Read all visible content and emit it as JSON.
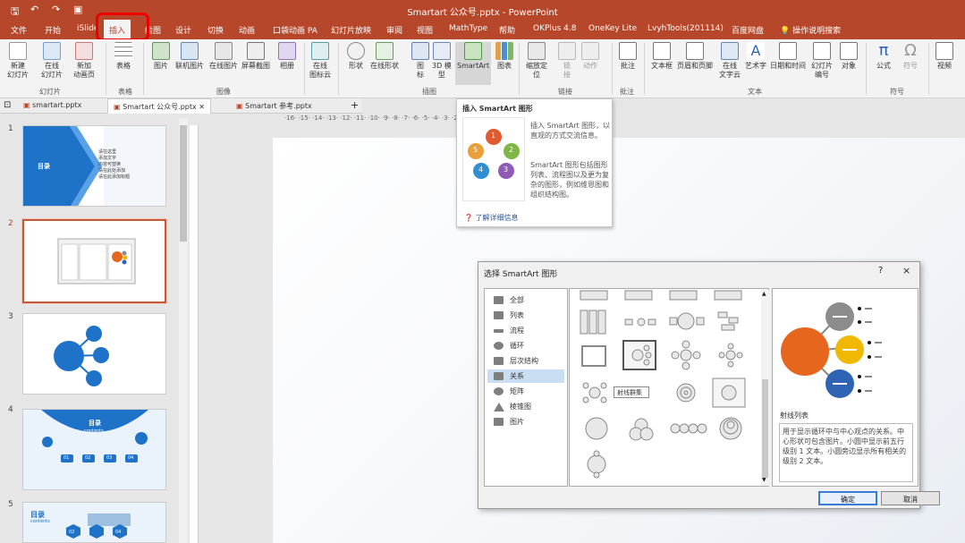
{
  "window": {
    "title": "Smartart 公众号.pptx - PowerPoint",
    "quick_access": [
      "保存",
      "撤销",
      "重做",
      "开始放映"
    ]
  },
  "menu_tabs": [
    "文件",
    "开始",
    "iSlide",
    "插入",
    "绘图",
    "设计",
    "切换",
    "动画",
    "口袋动画 PA",
    "幻灯片放映",
    "审阅",
    "视图",
    "MathType",
    "帮助",
    "OKPlus 4.8",
    "OneKey Lite",
    "LvyhTools(201114)",
    "百度网盘",
    "操作说明搜索"
  ],
  "active_tab": "插入",
  "ribbon": {
    "buttons": [
      {
        "label": "新建\n幻灯片"
      },
      {
        "label": "在线\n幻灯片"
      },
      {
        "label": "新加\n动画页"
      },
      {
        "label": "表格"
      },
      {
        "label": "图片"
      },
      {
        "label": "联机图片"
      },
      {
        "label": "在线图片"
      },
      {
        "label": "屏幕截图"
      },
      {
        "label": "相册"
      },
      {
        "label": "在线\n图标云"
      },
      {
        "label": "形状"
      },
      {
        "label": "在线形状"
      },
      {
        "label": "图\n标"
      },
      {
        "label": "3D 模\n型"
      },
      {
        "label": "SmartArt"
      },
      {
        "label": "图表"
      },
      {
        "label": "缩放定\n位"
      },
      {
        "label": "链\n接"
      },
      {
        "label": "动作"
      },
      {
        "label": "批注"
      },
      {
        "label": "文本框"
      },
      {
        "label": "页眉和页脚"
      },
      {
        "label": "在线\n文字云"
      },
      {
        "label": "艺术字"
      },
      {
        "label": "日期和时间"
      },
      {
        "label": "幻灯片\n编号"
      },
      {
        "label": "对象"
      },
      {
        "label": "公式"
      },
      {
        "label": "符号"
      },
      {
        "label": "视频"
      }
    ],
    "groups": [
      "幻灯片",
      "表格",
      "图像",
      "插图",
      "链接",
      "批注",
      "文本",
      "符号"
    ]
  },
  "doc_tabs": [
    "smartart.pptx",
    "Smartart 公众号.pptx",
    "Smartart 参考.pptx"
  ],
  "ruler_text": "·16·  ·15·  ·14·  ·13·  ·12·  ·11·  ·10·  ·9·  ·8·  ·7·  ·6·  ·5·  ·4·  ·3·  ·2·",
  "slides": [
    {
      "num": "1",
      "title": "目录",
      "items": [
        "请在这里",
        "添加文字",
        "内容可替换",
        "请在此处添加",
        "请在此添加标题"
      ]
    },
    {
      "num": "2"
    },
    {
      "num": "3"
    },
    {
      "num": "4",
      "title": "目录",
      "subtitle": "contents",
      "badges": [
        "01",
        "02",
        "03",
        "04"
      ]
    },
    {
      "num": "5",
      "title": "目录",
      "subtitle": "contents",
      "badges": [
        "02",
        "04"
      ]
    }
  ],
  "tooltip": {
    "title": "插入 SmartArt 图形",
    "desc1": "插入 SmartArt 图形，以直观的方式交流信息。",
    "desc2": "SmartArt 图形包括图形列表、流程图以及更为复杂的图形，例如维恩图和组织结构图。",
    "link": "了解详细信息",
    "badge_nums": [
      "1",
      "2",
      "3",
      "4",
      "5"
    ]
  },
  "dialog": {
    "title": "选择 SmartArt 图形",
    "help": "?",
    "close": "×",
    "categories": [
      "全部",
      "列表",
      "流程",
      "循环",
      "层次结构",
      "关系",
      "矩阵",
      "棱锥图",
      "图片"
    ],
    "active_category": "关系",
    "hover_tip": "射线群集",
    "preview_name": "射线列表",
    "preview_desc": "用于显示循环中与中心观点的关系。中心形状可包含图片。小圆中显示前五行级别 1 文本。小圆旁边显示所有相关的级别 2 文本。",
    "ok": "确定",
    "cancel": "取消"
  },
  "colors": {
    "accent": "#b7472a",
    "slide_blue": "#1e73c9",
    "preview_orange": "#e5661c",
    "preview_gray": "#8c8c8c",
    "preview_yellow": "#f0b800",
    "preview_blue": "#2f64b5"
  }
}
